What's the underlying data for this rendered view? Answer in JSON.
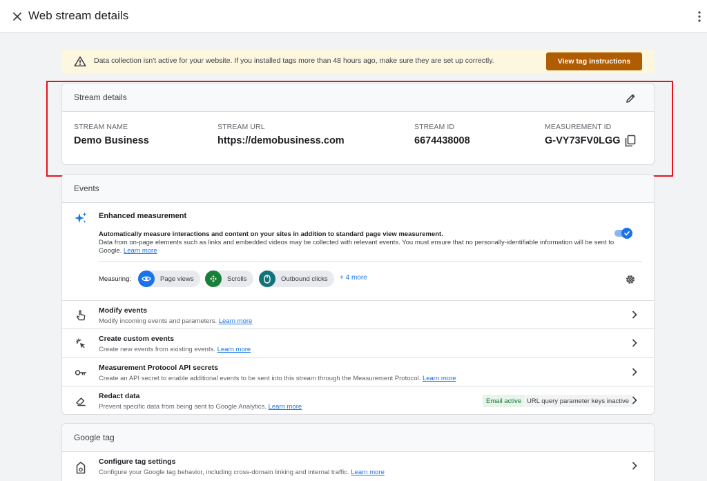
{
  "header": {
    "title": "Web stream details"
  },
  "banner": {
    "text": "Data collection isn't active for your website. If you installed tags more than 48 hours ago, make sure they are set up correctly.",
    "button_label": "View tag instructions"
  },
  "stream": {
    "title": "Stream details",
    "columns": [
      {
        "label": "STREAM NAME",
        "value": "Demo Business"
      },
      {
        "label": "STREAM URL",
        "value": "https://demobusiness.com"
      },
      {
        "label": "STREAM ID",
        "value": "6674438008"
      },
      {
        "label": "MEASUREMENT ID",
        "value": "G-VY73FV0LGG"
      }
    ]
  },
  "events": {
    "title": "Events",
    "enhanced": {
      "title": "Enhanced measurement",
      "desc_bold": "Automatically measure interactions and content on your sites in addition to standard page view measurement.",
      "desc": "Data from on-page elements such as links and embedded videos may be collected with relevant events. You must ensure that no personally-identifiable information will be sent to Google.",
      "learn_more": "Learn more",
      "toggle_on": true,
      "measuring_label": "Measuring:",
      "chips": [
        "Page views",
        "Scrolls",
        "Outbound clicks"
      ],
      "more": "+ 4 more"
    },
    "rows": [
      {
        "title": "Modify events",
        "desc": "Modify incoming events and parameters.",
        "link": "Learn more"
      },
      {
        "title": "Create custom events",
        "desc": "Create new events from existing events.",
        "link": "Learn more"
      },
      {
        "title": "Measurement Protocol API secrets",
        "desc": "Create an API secret to enable additional events to be sent into this stream through the Measurement Protocol.",
        "link": "Learn more"
      },
      {
        "title": "Redact data",
        "desc": "Prevent specific data from being sent to Google Analytics.",
        "link": "Learn more",
        "badges": [
          "Email active",
          "URL query parameter keys inactive"
        ]
      }
    ]
  },
  "google_tag": {
    "title": "Google tag",
    "rows": [
      {
        "title": "Configure tag settings",
        "desc": "Configure your Google tag behavior, including cross-domain linking and internal traffic.",
        "link": "Learn more"
      }
    ]
  },
  "colors": {
    "accent": "#1a73e8",
    "banner_bg": "#fef7e0",
    "banner_button": "#b05c00",
    "highlight": "#e8111b",
    "chip_page_views": "#1a73e8",
    "chip_scrolls": "#188038",
    "chip_outbound": "#12737a"
  }
}
